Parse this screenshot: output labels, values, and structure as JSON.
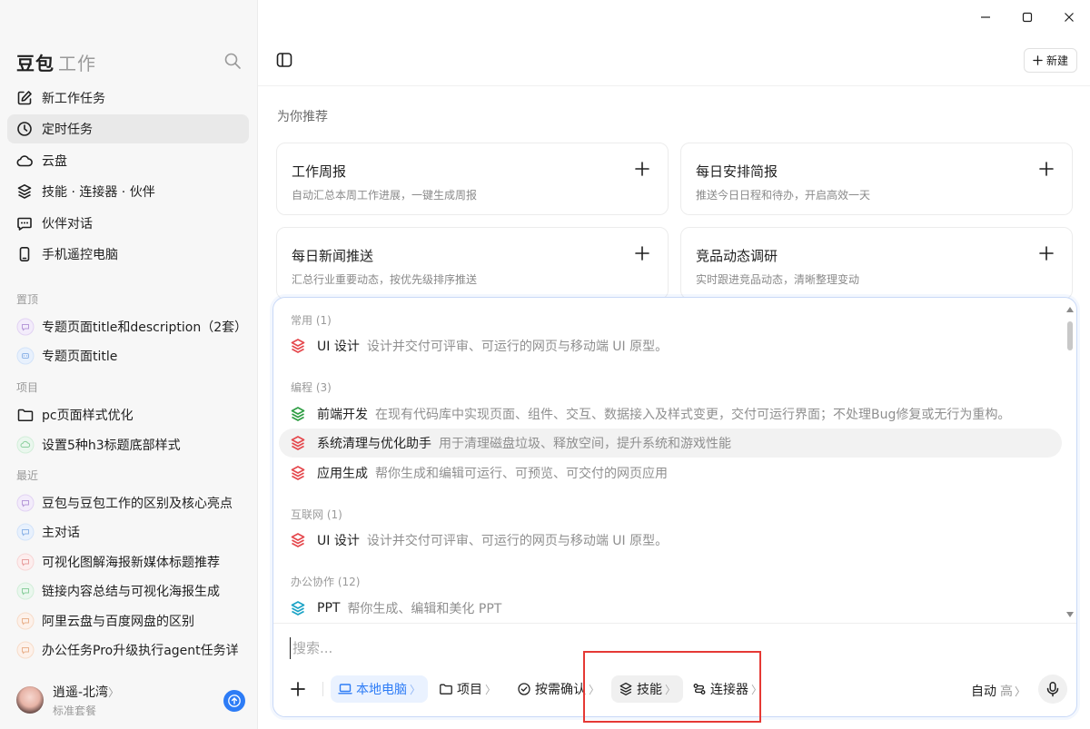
{
  "brand": {
    "name": "豆包",
    "sub": "工作"
  },
  "nav": [
    {
      "label": "新工作任务",
      "icon": "edit-icon",
      "active": false
    },
    {
      "label": "定时任务",
      "icon": "clock-icon",
      "active": true
    },
    {
      "label": "云盘",
      "icon": "cloud-icon",
      "active": false
    },
    {
      "label": "技能 · 连接器 · 伙伴",
      "icon": "layers-icon",
      "active": false
    },
    {
      "label": "伙伴对话",
      "icon": "chat-bubble-icon",
      "active": false
    },
    {
      "label": "手机遥控电脑",
      "icon": "phone-icon",
      "active": false
    }
  ],
  "sections": {
    "pinned": "置顶",
    "projects": "项目",
    "recent": "最近"
  },
  "pinned": [
    {
      "label": "专题页面title和description（2套）"
    },
    {
      "label": "专题页面title"
    }
  ],
  "projects": [
    {
      "label": "pc页面样式优化"
    },
    {
      "label": "设置5种h3标题底部样式"
    }
  ],
  "recent": [
    {
      "label": "豆包与豆包工作的区别及核心亮点"
    },
    {
      "label": "主对话"
    },
    {
      "label": "可视化图解海报新媒体标题推荐"
    },
    {
      "label": "链接内容总结与可视化海报生成"
    },
    {
      "label": "阿里云盘与百度网盘的区别"
    },
    {
      "label": "办公任务Pro升级执行agent任务详"
    }
  ],
  "user": {
    "name": "逍遥-北湾",
    "chevron": "〉",
    "plan": "标准套餐"
  },
  "header": {
    "new_label": "新建"
  },
  "recommend": {
    "title": "为你推荐",
    "cards": [
      {
        "title": "工作周报",
        "desc": "自动汇总本周工作进展，一键生成周报"
      },
      {
        "title": "每日安排简报",
        "desc": "推送今日日程和待办，开启高效一天"
      },
      {
        "title": "每日新闻推送",
        "desc": "汇总行业重要动态，按优先级排序推送"
      },
      {
        "title": "竞品动态调研",
        "desc": "实时跟进竞品动态，清晰整理变动"
      }
    ]
  },
  "skills": {
    "groups": [
      {
        "label": "常用 (1)"
      },
      {
        "label": "编程 (3)"
      },
      {
        "label": "互联网 (1)"
      },
      {
        "label": "办公协作 (12)"
      }
    ],
    "items": [
      {
        "name": "UI 设计",
        "desc": "设计并交付可评审、可运行的网页与移动端 UI 原型。",
        "color": "#e5484d"
      },
      {
        "name": "前端开发",
        "desc": "在现有代码库中实现页面、组件、交互、数据接入及样式变更，交付可运行界面；不处理Bug修复或无行为重构。",
        "color": "#2f9e44"
      },
      {
        "name": "系统清理与优化助手",
        "desc": "用于清理磁盘垃圾、释放空间，提升系统和游戏性能",
        "color": "#e5484d"
      },
      {
        "name": "应用生成",
        "desc": "帮你生成和编辑可运行、可预览、可交付的网页应用",
        "color": "#e5484d"
      },
      {
        "name": "UI 设计",
        "desc": "设计并交付可评审、可运行的网页与移动端 UI 原型。",
        "color": "#e5484d"
      },
      {
        "name": "PPT",
        "desc": "帮你生成、编辑和美化 PPT",
        "color": "#1ba3c6"
      }
    ]
  },
  "composer": {
    "placeholder": "搜索...",
    "chips": [
      {
        "label": "本地电脑",
        "chevron": "〉"
      },
      {
        "label": "项目",
        "chevron": "〉"
      },
      {
        "label": "按需确认",
        "chevron": "〉"
      },
      {
        "label": "技能",
        "chevron": "〉"
      },
      {
        "label": "连接器",
        "chevron": "〉"
      }
    ],
    "mode": "自动",
    "level": "高",
    "level_chevron": "〉"
  },
  "colors": {
    "accent": "#2d7cf6",
    "highlight_box": "#e53935"
  }
}
